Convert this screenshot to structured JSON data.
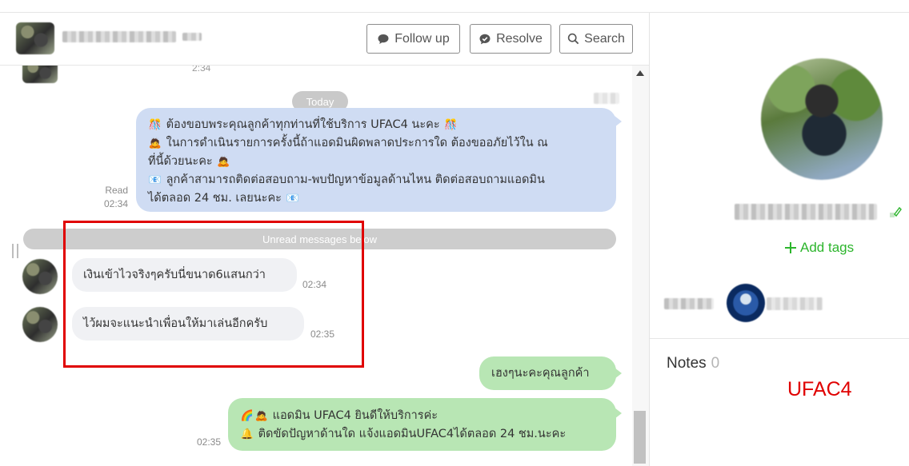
{
  "header": {
    "follow_up_label": "Follow up",
    "resolve_label": "Resolve",
    "search_label": "Search",
    "prev_time": "2:34"
  },
  "chat": {
    "date_divider": "Today",
    "unread_divider": "Unread messages below",
    "messages": [
      {
        "direction": "outgoing",
        "lines": [
          "ต้องขอบพระคุณลูกค้าทุกท่านที่ใช้บริการ UFAC4 นะคะ",
          "ในการดำเนินรายการครั้งนี้ถ้าแอดมินผิดพลาดประการใด ต้องขออภัยไว้ใน ณ",
          "ที่นี้ด้วยนะคะ",
          "ลูกค้าสามารถติดต่อสอบถาม-พบปัญหาข้อมูลด้านไหน ติดต่อสอบถามแอดมิน",
          "ได้ตลอด 24 ชม. เลยนะคะ"
        ],
        "status": "Read",
        "time": "02:34"
      },
      {
        "direction": "incoming",
        "text": "เงินเข้าไวจริงๆครับนี่ขนาด6แสนกว่า",
        "time": "02:34"
      },
      {
        "direction": "incoming",
        "text": "ไว้ผมจะแนะนำเพื่อนให้มาเล่นอีกครับ",
        "time": "02:35"
      },
      {
        "direction": "outgoing",
        "text": "เฮงๆนะคะคุณลูกค้า"
      },
      {
        "direction": "outgoing",
        "lines": [
          "แอดมิน UFAC4 ยินดีให้บริการค่ะ",
          "ติดขัดปัญหาด้านใด แจ้งแอดมินUFAC4ได้ตลอด 24 ชม.นะคะ"
        ],
        "time": "02:35"
      }
    ]
  },
  "sidebar": {
    "add_tags_label": "Add tags",
    "notes_label": "Notes",
    "notes_count": "0",
    "notes_text": "UFAC4"
  },
  "colors": {
    "outgoing_blue": "#cfdcf3",
    "outgoing_green": "#b8e6b4",
    "incoming": "#f0f1f4",
    "accent_green": "#2cb52c",
    "highlight_red": "#e00000"
  }
}
